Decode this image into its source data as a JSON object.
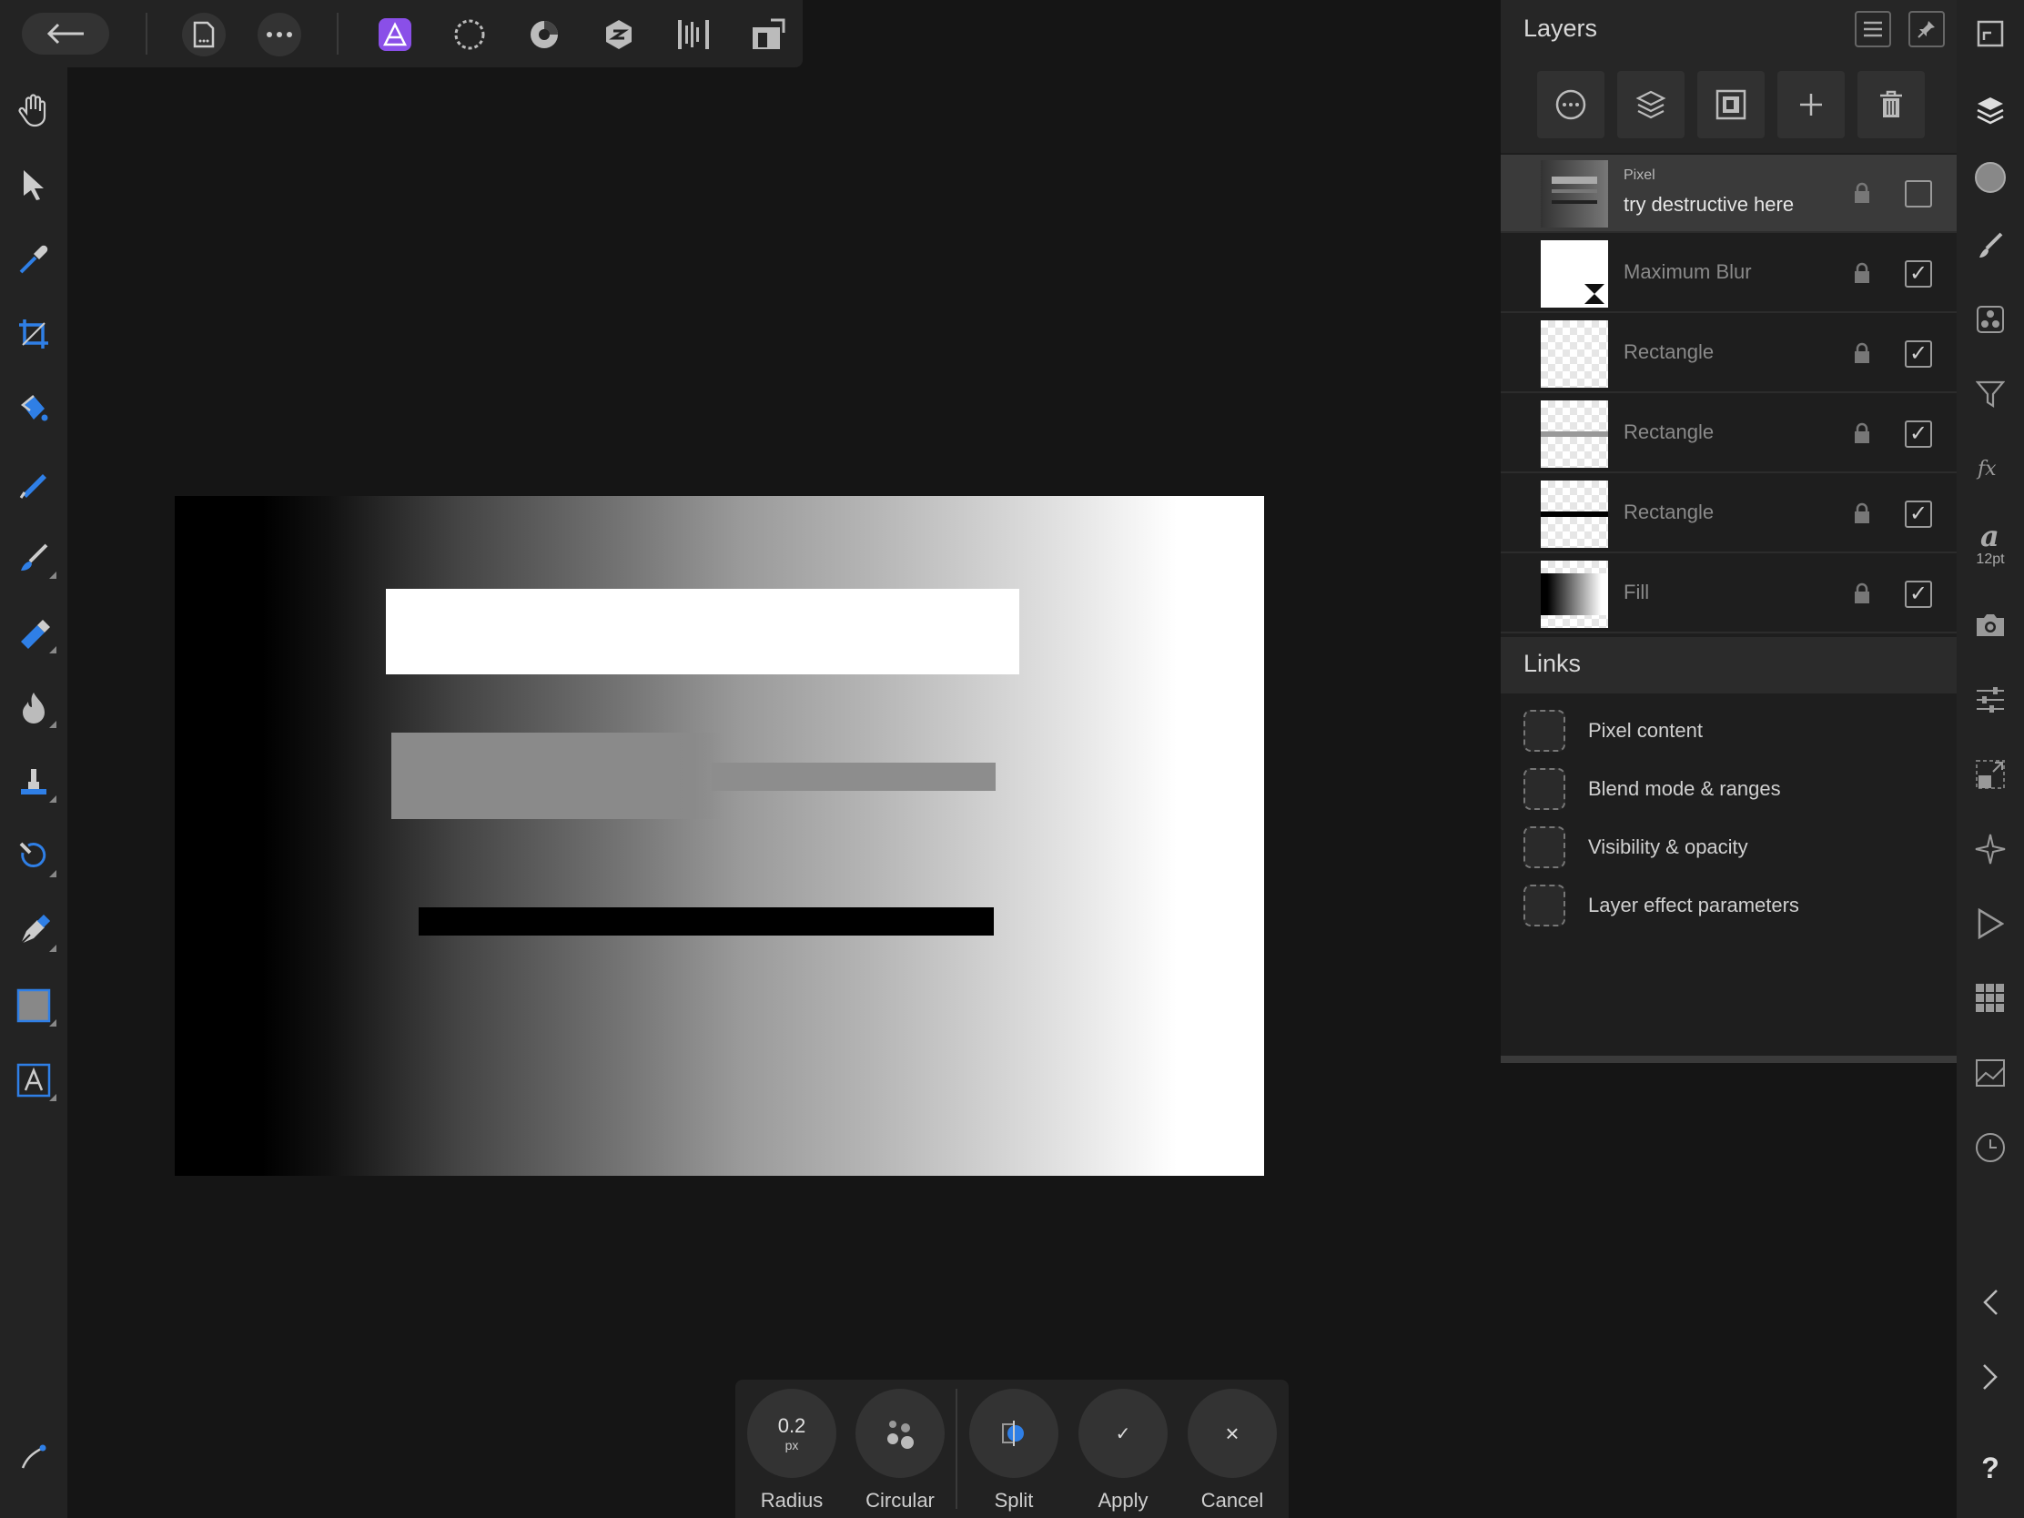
{
  "toolbar": {
    "back_icon": "arrow-left-icon",
    "document_icon": "document-icon",
    "more_icon": "more-icon",
    "personas": [
      "photo-persona-icon",
      "liquify-persona-icon",
      "develop-persona-icon",
      "tone-mapping-persona-icon",
      "export-persona-icon"
    ],
    "view_icon": "view-mode-icon"
  },
  "tools": [
    "hand-icon",
    "move-icon",
    "color-picker-icon",
    "crop-icon",
    "flood-fill-icon",
    "selection-brush-icon",
    "paint-brush-icon",
    "erase-brush-icon",
    "burn-brush-icon",
    "clone-brush-icon",
    "healing-brush-icon",
    "pen-icon",
    "rectangle-icon",
    "text-icon"
  ],
  "layers_panel": {
    "title": "Layers",
    "selected_layer_type": "Pixel",
    "layers": [
      {
        "name": "try destructive here",
        "type": "Pixel",
        "visible": false,
        "selected": true
      },
      {
        "name": "Maximum Blur",
        "visible": true,
        "selected": false
      },
      {
        "name": "Rectangle",
        "visible": true,
        "selected": false
      },
      {
        "name": "Rectangle",
        "visible": true,
        "selected": false
      },
      {
        "name": "Rectangle",
        "visible": true,
        "selected": false
      },
      {
        "name": "Fill",
        "visible": true,
        "selected": false
      }
    ],
    "checkmark": "✓"
  },
  "links_panel": {
    "title": "Links",
    "items": [
      "Pixel content",
      "Blend mode & ranges",
      "Visibility & opacity",
      "Layer effect parameters"
    ]
  },
  "studio": {
    "font_size_label": "12pt",
    "help_label": "?"
  },
  "context_bar": {
    "radius_value": "0.2",
    "radius_unit": "px",
    "radius_label": "Radius",
    "circular_label": "Circular",
    "split_label": "Split",
    "apply_label": "Apply",
    "cancel_label": "Cancel",
    "apply_glyph": "✓",
    "cancel_glyph": "×"
  },
  "colors": {
    "accent_blue": "#2f7fe6",
    "persona_purple": "#8a4fe8",
    "panel_bg": "#1e1e1e"
  }
}
